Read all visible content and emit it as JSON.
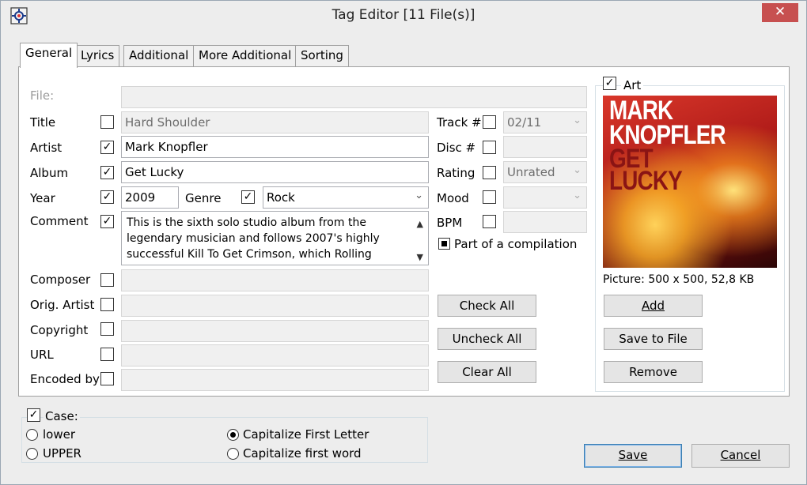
{
  "window": {
    "title": "Tag Editor [11 File(s)]",
    "close_glyph": "✕"
  },
  "tabs": [
    {
      "label": "General",
      "active": true
    },
    {
      "label": "Lyrics",
      "active": false
    },
    {
      "label": "Additional",
      "active": false
    },
    {
      "label": "More Additional",
      "active": false
    },
    {
      "label": "Sorting",
      "active": false
    }
  ],
  "general": {
    "file": {
      "label": "File:",
      "value": ""
    },
    "title": {
      "label": "Title",
      "checked": false,
      "value": "Hard Shoulder"
    },
    "artist": {
      "label": "Artist",
      "checked": true,
      "value": "Mark Knopfler"
    },
    "album": {
      "label": "Album",
      "checked": true,
      "value": "Get Lucky"
    },
    "year": {
      "label": "Year",
      "checked": true,
      "value": "2009"
    },
    "genre": {
      "label": "Genre",
      "checked": true,
      "value": "Rock"
    },
    "comment": {
      "label": "Comment",
      "checked": true,
      "value": "This is the sixth solo studio album from the legendary musician and follows 2007's highly successful Kill To Get Crimson, which Rolling"
    },
    "composer": {
      "label": "Composer",
      "checked": false,
      "value": ""
    },
    "orig_artist": {
      "label": "Orig. Artist",
      "checked": false,
      "value": ""
    },
    "copyright": {
      "label": "Copyright",
      "checked": false,
      "value": ""
    },
    "url": {
      "label": "URL",
      "checked": false,
      "value": ""
    },
    "encoded_by": {
      "label": "Encoded by",
      "checked": false,
      "value": ""
    },
    "track": {
      "label": "Track #",
      "checked": false,
      "value": "02/11"
    },
    "disc": {
      "label": "Disc #",
      "checked": false,
      "value": ""
    },
    "rating": {
      "label": "Rating",
      "checked": false,
      "value": "Unrated"
    },
    "mood": {
      "label": "Mood",
      "checked": false,
      "value": ""
    },
    "bpm": {
      "label": "BPM",
      "checked": false,
      "value": ""
    },
    "compilation": {
      "label": "Part of a compilation",
      "state": "indeterminate"
    },
    "check_all": "Check All",
    "uncheck_all": "Uncheck All",
    "clear_all": "Clear All"
  },
  "art": {
    "label": "Art",
    "checked": true,
    "cover_text_line1": "MARK",
    "cover_text_line2": "KNOPFLER",
    "cover_text_line3": "GET",
    "cover_text_line4": "LUCKY",
    "picture_info": "Picture: 500 x 500, 52,8 KB",
    "add": "Add",
    "save_to_file": "Save to File",
    "remove": "Remove"
  },
  "case": {
    "label": "Case:",
    "checked": true,
    "options": [
      {
        "label": "lower",
        "selected": false
      },
      {
        "label": "UPPER",
        "selected": false
      },
      {
        "label": "Capitalize First Letter",
        "selected": true
      },
      {
        "label": "Capitalize first word",
        "selected": false
      }
    ]
  },
  "footer": {
    "save": "Save",
    "cancel": "Cancel"
  },
  "icons": {
    "check": "✓",
    "dropdown": "⌄",
    "scroll_up": "▲",
    "scroll_down": "▼"
  }
}
